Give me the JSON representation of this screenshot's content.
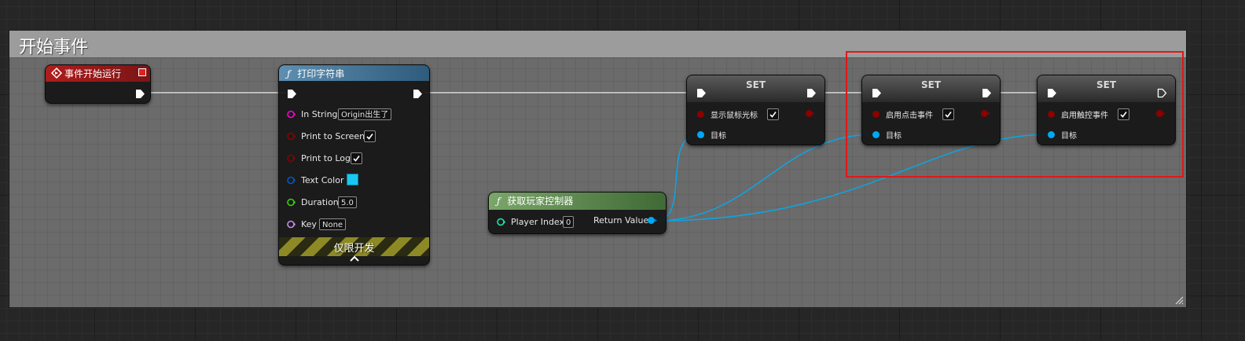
{
  "comment": {
    "title": "开始事件"
  },
  "event_node": {
    "title": "事件开始运行"
  },
  "print_node": {
    "title": "打印字符串",
    "pins": {
      "in_string": {
        "label": "In String",
        "value": "Origin出生了"
      },
      "print_to_screen": {
        "label": "Print to Screen",
        "checked": true
      },
      "print_to_log": {
        "label": "Print to Log",
        "checked": true
      },
      "text_color": {
        "label": "Text Color",
        "value_color": "#19c8f0"
      },
      "duration": {
        "label": "Duration",
        "value": "5.0"
      },
      "key": {
        "label": "Key",
        "value": "None"
      }
    },
    "dev_only_label": "仅限开发"
  },
  "get_controller_node": {
    "title": "获取玩家控制器",
    "player_index": {
      "label": "Player Index",
      "value": "0"
    },
    "return_value_label": "Return Value"
  },
  "set_nodes": [
    {
      "title": "SET",
      "property": "显示鼠标光标",
      "checked": true,
      "target_label": "目标"
    },
    {
      "title": "SET",
      "property": "启用点击事件",
      "checked": true,
      "target_label": "目标"
    },
    {
      "title": "SET",
      "property": "启用触控事件",
      "checked": true,
      "target_label": "目标"
    }
  ],
  "colors": {
    "exec": "#ffffff",
    "bool_pin": "#8c0000",
    "object_pin": "#00a8f3",
    "string_pin": "#ff00d0",
    "struct_pin": "#0058c8",
    "float_pin": "#38d500",
    "name_pin": "#c88cf0",
    "int_pin": "#1fe3af",
    "event_header": "#b01c1c",
    "function_header": "#3f6c8c",
    "pure_function_header": "#5b8a4a",
    "selection": "#e01818"
  }
}
